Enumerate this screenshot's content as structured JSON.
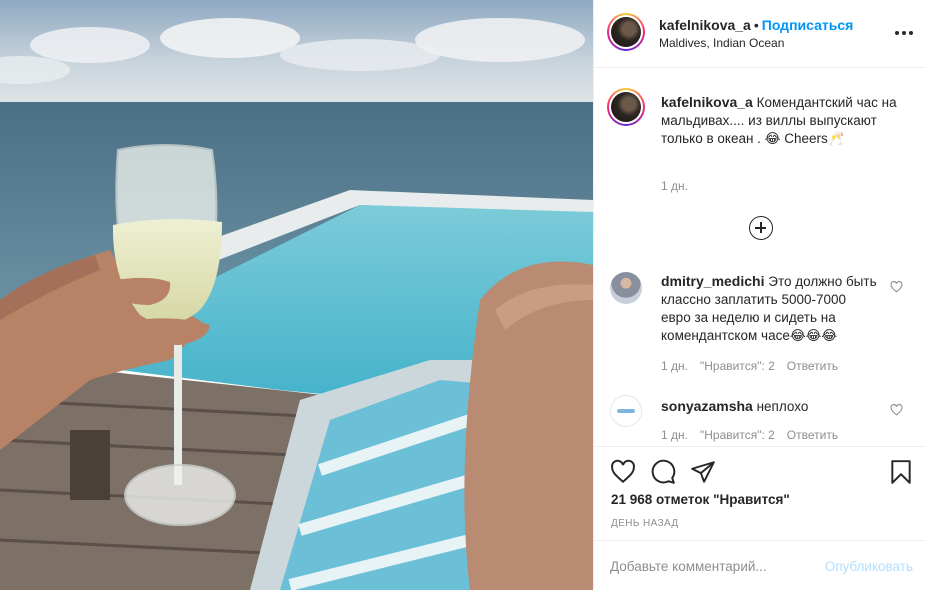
{
  "post": {
    "username": "kafelnikova_a",
    "separator": "•",
    "follow_label": "Подписаться",
    "location": "Maldives, Indian Ocean",
    "more_icon": "more-horizontal-icon"
  },
  "caption": {
    "username": "kafelnikova_a",
    "text": "Комендантский час на мальдивах.... из виллы выпускают только в океан . 😂 Cheers🥂",
    "time": "1 дн."
  },
  "load_more_icon": "plus-circle-icon",
  "comments": [
    {
      "username": "dmitry_medichi",
      "text": "Это должно быть классно заплатить 5000-7000 евро за неделю и сидеть на комендантском часе😂😂😂",
      "time": "1 дн.",
      "likes": "\"Нравится\": 2",
      "reply": "Ответить"
    },
    {
      "username": "sonyazamsha",
      "text": "неплохо",
      "time": "1 дн.",
      "likes": "\"Нравится\": 2",
      "reply": "Ответить"
    }
  ],
  "actions": {
    "like_icon": "heart-icon",
    "comment_icon": "comment-icon",
    "share_icon": "share-icon",
    "save_icon": "bookmark-icon"
  },
  "likes_count": "21 968 отметок \"Нравится\"",
  "date": "ДЕНЬ НАЗАД",
  "add_comment": {
    "placeholder": "Добавьте комментарий...",
    "publish_label": "Опубликовать"
  },
  "colors": {
    "follow_blue": "#0095f6",
    "publish_disabled": "#b2dffc",
    "muted_text": "#8e8e8e"
  }
}
